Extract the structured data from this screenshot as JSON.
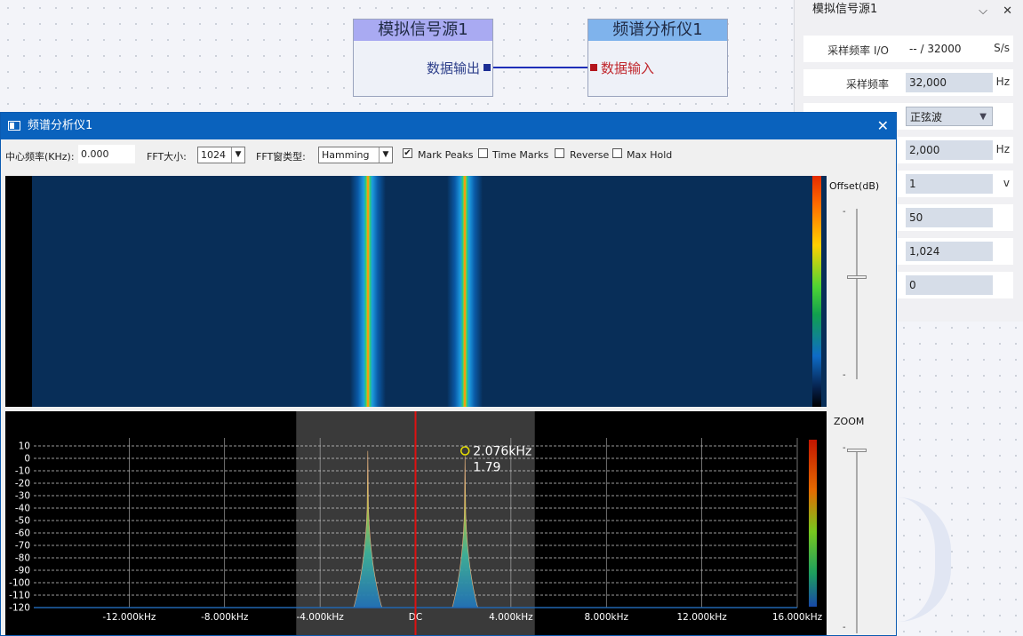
{
  "canvas": {
    "source_node": {
      "title": "模拟信号源1",
      "port": "数据输出"
    },
    "analyzer_node": {
      "title": "频谱分析仪1",
      "port": "数据输入"
    }
  },
  "prop_panel": {
    "title": "模拟信号源1",
    "rows": [
      {
        "label": "采样频率 I/O",
        "value": "-- / 32000",
        "unit": "S/s"
      },
      {
        "label": "采样频率",
        "value": "32,000",
        "unit": "Hz"
      },
      {
        "label": "",
        "value": "正弦波",
        "unit": ""
      },
      {
        "label": "",
        "value": "2,000",
        "unit": "Hz"
      },
      {
        "label": "",
        "value": "1",
        "unit": "v"
      },
      {
        "label": "",
        "value": "50",
        "unit": ""
      },
      {
        "label": "",
        "value": "1,024",
        "unit": ""
      },
      {
        "label": "",
        "value": "0",
        "unit": ""
      }
    ]
  },
  "window": {
    "title": "频谱分析仪1",
    "close_glyph": "✕",
    "toolbar": {
      "center_freq_label": "中心频率(KHz):",
      "center_freq_value": "0.000",
      "fft_size_label": "FFT大小:",
      "fft_size_value": "1024",
      "fft_window_label": "FFT窗类型:",
      "fft_window_value": "Hamming",
      "mark_peaks": {
        "label": "Mark Peaks",
        "checked": true
      },
      "time_marks": {
        "label": "Time Marks",
        "checked": false
      },
      "reverse": {
        "label": "Reverse",
        "checked": false
      },
      "max_hold": {
        "label": "Max Hold",
        "checked": false
      }
    },
    "offset_label": "Offset(dB)",
    "zoom_label": "ZOOM",
    "slider_tick": "-",
    "offset_level": 0.4,
    "zoom_level": 0.0
  },
  "chart_data": {
    "type": "line",
    "xlabel": "",
    "ylabel": "",
    "x_tick_labels": [
      "-12.000kHz",
      "-8.000kHz",
      "-4.000kHz",
      "DC",
      "4.000kHz",
      "8.000kHz",
      "12.000kHz",
      "16.000kHz"
    ],
    "x_ticks": [
      -12,
      -8,
      -4,
      0,
      4,
      8,
      12,
      16
    ],
    "xlim": [
      -16,
      16
    ],
    "ylim": [
      -120,
      10
    ],
    "y_ticks": [
      10,
      0,
      -10,
      -20,
      -30,
      -40,
      -50,
      -60,
      -70,
      -80,
      -90,
      -100,
      -110,
      -120
    ],
    "grid": true,
    "selection_range_khz": [
      -5,
      5
    ],
    "center_marker_khz": 0,
    "peaks": [
      {
        "freq_khz": -2.0,
        "db": 6
      },
      {
        "freq_khz": 2.076,
        "db": 1.79
      }
    ],
    "peak_annotation": {
      "freq_label": "2.076kHz",
      "value_label": "1.79"
    },
    "noise_floor_db": -120
  }
}
